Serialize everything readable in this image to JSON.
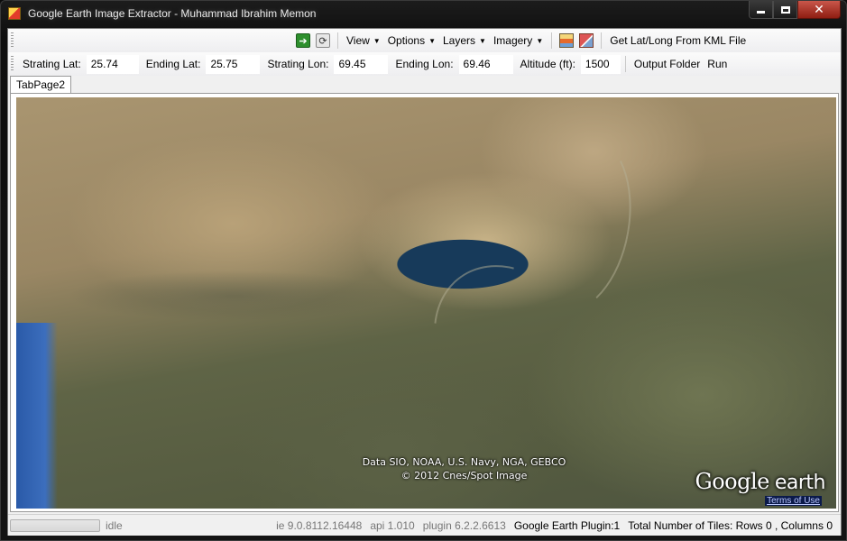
{
  "window": {
    "title": "Google Earth Image Extractor - Muhammad Ibrahim Memon"
  },
  "toolbar1": {
    "menus": [
      {
        "label": "View"
      },
      {
        "label": "Options"
      },
      {
        "label": "Layers"
      },
      {
        "label": "Imagery"
      }
    ],
    "kml_button": "Get Lat/Long From KML File"
  },
  "toolbar2": {
    "start_lat_label": "Strating Lat:",
    "start_lat_value": "25.74",
    "end_lat_label": "Ending Lat:",
    "end_lat_value": "25.75",
    "start_lon_label": "Strating Lon:",
    "start_lon_value": "69.45",
    "end_lon_label": "Ending Lon:",
    "end_lon_value": "69.46",
    "altitude_label": "Altitude (ft):",
    "altitude_value": "1500",
    "output_folder": "Output Folder",
    "run": "Run"
  },
  "tabs": [
    {
      "label": "TabPage2"
    }
  ],
  "map": {
    "attribution_line1": "Data SIO, NOAA, U.S. Navy, NGA, GEBCO",
    "attribution_line2": "© 2012 Cnes/Spot Image",
    "logo_google": "Google",
    "logo_earth": "earth",
    "terms": "Terms of Use"
  },
  "status": {
    "progress": 0,
    "state": "idle",
    "ie_version": "ie 9.0.8112.16448",
    "api_version": "api 1.010",
    "plugin_version": "plugin 6.2.2.6613",
    "plugin_status": "Google Earth Plugin:1",
    "tiles": "Total Number of Tiles: Rows 0 , Columns 0"
  }
}
